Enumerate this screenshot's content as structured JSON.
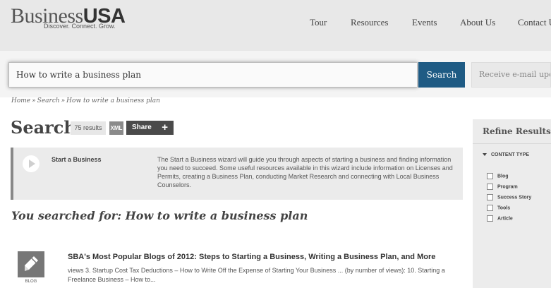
{
  "header": {
    "logo_light": "Business",
    "logo_bold": "USA",
    "tagline": "Discover. Connect. Grow.",
    "nav": [
      "Tour",
      "Resources",
      "Events",
      "About Us",
      "Contact U"
    ]
  },
  "search": {
    "value": "How to write a business plan",
    "button_label": "Search",
    "email_label": "Receive e-mail upda"
  },
  "breadcrumb": {
    "items": [
      "Home",
      "Search",
      "How to write a business plan"
    ],
    "separator": "»"
  },
  "main": {
    "title": "Search",
    "results_count": "75 results",
    "xml_label": "XML",
    "share_label": "Share",
    "share_plus": "+"
  },
  "wizard": {
    "title": "Start a Business",
    "description": "The Start a Business wizard will guide you through aspects of starting a business and finding information you need to succeed. Some useful resources available in this wizard include information on Licenses and Permits, creating a Business Plan, conducting Market Research and connecting with Local Business Counselors."
  },
  "you_searched": "You searched for: How to write a business plan",
  "results": [
    {
      "type": "BLOG",
      "title": "SBA's Most Popular Blogs of 2012: Steps to Starting a Business, Writing a Business Plan, and More",
      "snippet": "views 3.        Startup Cost Tax Deductions – How to Write Off the Expense of Starting Your Business ... (by number of views): 10. Starting a Freelance Business – How to..."
    }
  ],
  "sidebar": {
    "title": "Refine Results",
    "facet_heading": "CONTENT TYPE",
    "facets": [
      "Blog",
      "Program",
      "Success Story",
      "Tools",
      "Article"
    ]
  },
  "colors": {
    "accent": "#1f5b84",
    "header_bg": "#e8e8e8"
  }
}
